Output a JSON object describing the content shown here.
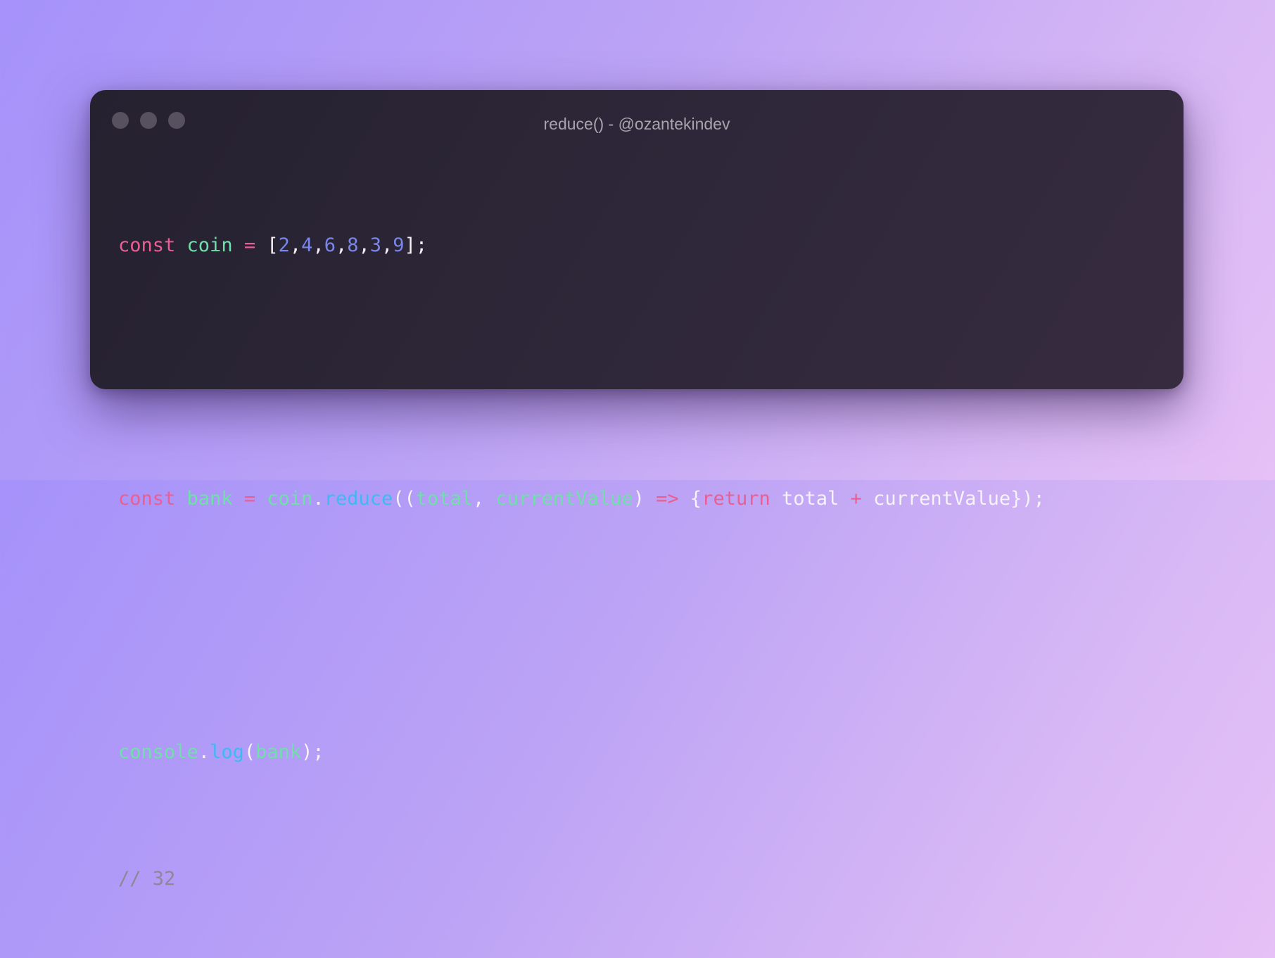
{
  "window": {
    "title": "reduce() - @ozantekindev",
    "controls": [
      "close",
      "minimize",
      "maximize"
    ]
  },
  "colors": {
    "keyword": "#ea5e93",
    "identifier": "#6ee0a8",
    "number": "#7a86e9",
    "function": "#3fb9f2",
    "plain": "#f5f3f7",
    "comment": "#8d8796",
    "window_bg": "#2e2739"
  },
  "code": {
    "line1": {
      "kw": "const",
      "var": "coin",
      "eq": "=",
      "open": "[",
      "n1": "2",
      "n2": "4",
      "n3": "6",
      "n4": "8",
      "n5": "3",
      "n6": "9",
      "comma": ",",
      "close": "];"
    },
    "line3": {
      "kw": "const",
      "var": "bank",
      "eq": "=",
      "obj": "coin",
      "dot": ".",
      "method": "reduce",
      "paren_open": "((",
      "param1": "total",
      "comma": ", ",
      "param2": "currentValue",
      "paren_close": ")",
      "arrow": "=>",
      "brace_open": "{",
      "ret": "return",
      "ref1": "total",
      "plus": "+",
      "ref2": "currentValue",
      "brace_close": "});"
    },
    "line5": {
      "obj": "console",
      "dot": ".",
      "method": "log",
      "paren_open": "(",
      "arg": "bank",
      "paren_close": ");"
    },
    "line6": {
      "comment": "// 32"
    }
  }
}
